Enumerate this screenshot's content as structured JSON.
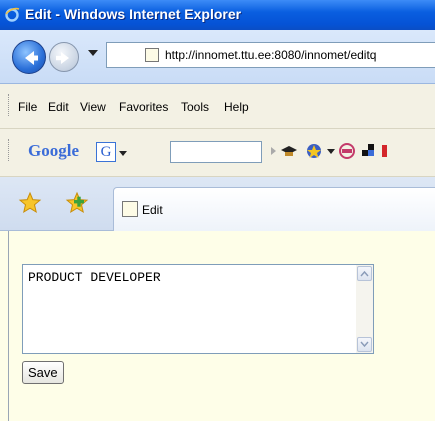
{
  "window": {
    "title": "Edit - Windows Internet Explorer"
  },
  "address_bar": {
    "url": "http://innomet.ttu.ee:8080/innomet/editq"
  },
  "menu": {
    "items": [
      "File",
      "Edit",
      "View",
      "Favorites",
      "Tools",
      "Help"
    ]
  },
  "google_toolbar": {
    "logo": "Google",
    "g_button": "G",
    "search_value": ""
  },
  "tabs": [
    {
      "label": "Edit"
    }
  ],
  "form": {
    "textarea_value": "PRODUCT DEVELOPER",
    "save_label": "Save"
  },
  "colors": {
    "titlebar": "#0553d6",
    "content_background": "#fefee8"
  }
}
